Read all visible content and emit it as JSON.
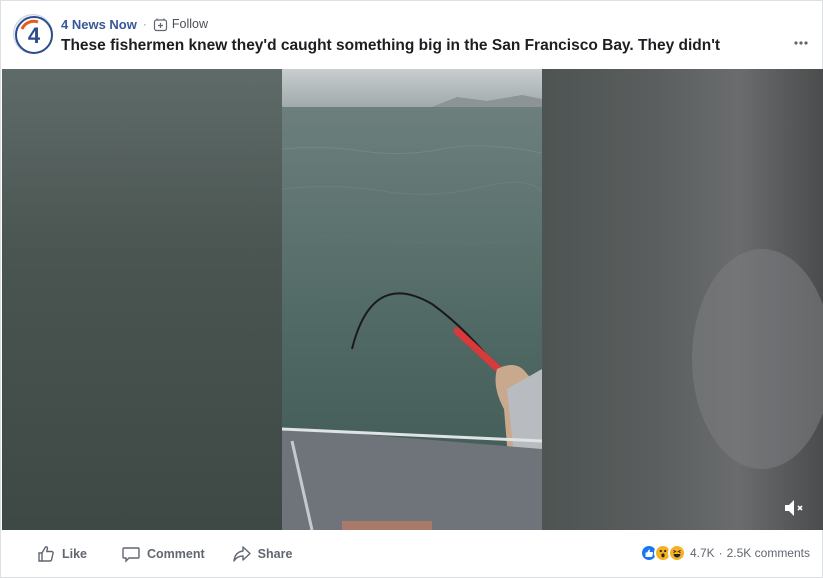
{
  "post": {
    "page_name": "4 News Now",
    "separator": "·",
    "follow_label": "Follow",
    "title": "These fishermen knew they'd caught something big in the San Francisco Bay. They didn't",
    "more_icon": "more-options-icon"
  },
  "video": {
    "muted": true,
    "volume_icon": "volume-muted-icon"
  },
  "actions": {
    "like_label": "Like",
    "comment_label": "Comment",
    "share_label": "Share"
  },
  "stats": {
    "reactions": [
      "like",
      "wow",
      "haha"
    ],
    "reaction_count": "4.7K",
    "separator": "·",
    "comments": "2.5K comments"
  },
  "colors": {
    "link": "#385898",
    "action_text": "#606770",
    "like_blue": "#1877f2",
    "reaction_yellow": "#f7b125"
  }
}
